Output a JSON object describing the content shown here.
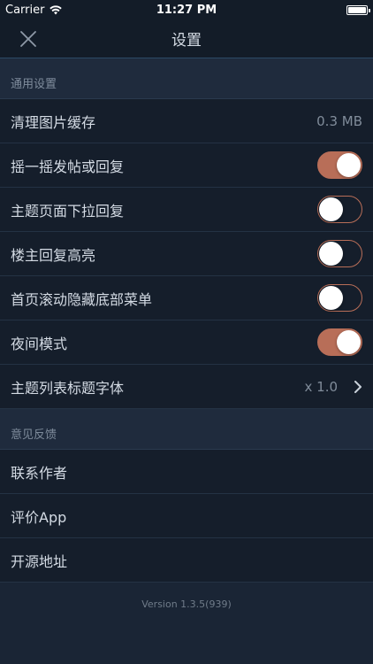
{
  "status": {
    "carrier": "Carrier",
    "time": "11:27 PM"
  },
  "nav": {
    "title": "设置"
  },
  "sections": {
    "general": {
      "header": "通用设置",
      "clear_cache": {
        "label": "清理图片缓存",
        "value": "0.3 MB"
      },
      "shake_reply": {
        "label": "摇一摇发帖或回复",
        "on": true
      },
      "pull_reply": {
        "label": "主题页面下拉回复",
        "on": false
      },
      "highlight_op": {
        "label": "楼主回复高亮",
        "on": false
      },
      "hide_bottom_menu": {
        "label": "首页滚动隐藏底部菜单",
        "on": false
      },
      "night_mode": {
        "label": "夜间模式",
        "on": true
      },
      "title_font": {
        "label": "主题列表标题字体",
        "value": "x 1.0"
      }
    },
    "feedback": {
      "header": "意见反馈",
      "contact": {
        "label": "联系作者"
      },
      "rate": {
        "label": "评价App"
      },
      "source": {
        "label": "开源地址"
      }
    }
  },
  "footer": {
    "version": "Version 1.3.5(939)"
  },
  "colors": {
    "accent": "#b86e58",
    "background": "#1a2535",
    "row": "#151e2b"
  },
  "icons": {
    "close": "close-icon",
    "chevron": "chevron-right-icon",
    "wifi": "wifi-icon",
    "battery": "battery-icon"
  }
}
